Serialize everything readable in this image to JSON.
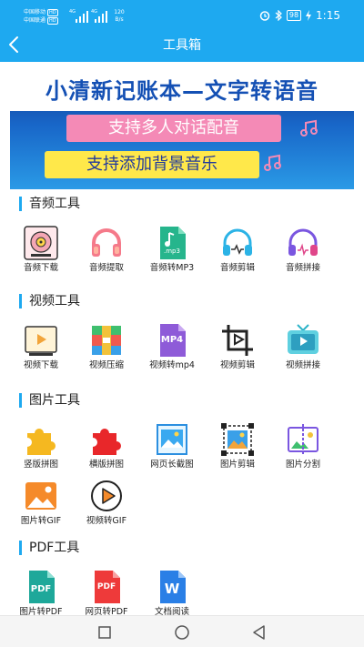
{
  "status_bar": {
    "carrier1": "中国移动",
    "carrier1_tag": "HD",
    "carrier2": "中国联通",
    "carrier2_tag": "HD",
    "network1": "4G",
    "network2": "4G",
    "speed_value": "120",
    "speed_unit": "B/s",
    "battery": "98",
    "time": "1:15"
  },
  "header": {
    "title": "工具箱"
  },
  "banner": {
    "title": "小清新记账本—文字转语音",
    "line1": "支持多人对话配音",
    "line2": "支持添加背景音乐"
  },
  "sections": {
    "audio": {
      "title": "音频工具",
      "items": [
        "音频下载",
        "音频提取",
        "音频转MP3",
        "音频剪辑",
        "音频拼接"
      ]
    },
    "video": {
      "title": "视频工具",
      "items": [
        "视频下载",
        "视频压缩",
        "视频转mp4",
        "视频剪辑",
        "视频拼接"
      ]
    },
    "image": {
      "title": "图片工具",
      "items": [
        "竖版拼图",
        "横版拼图",
        "网页长截图",
        "图片剪辑",
        "图片分割",
        "图片转GIF",
        "视频转GIF"
      ]
    },
    "pdf": {
      "title": "PDF工具",
      "items": [
        "图片转PDF",
        "网页转PDF",
        "文档阅读"
      ]
    }
  },
  "icon_labels": {
    "mp3": ".mp3",
    "mp4": "MP4",
    "pdf": "PDF",
    "word": "W"
  },
  "colors": {
    "accent": "#1ea9f0",
    "banner_pink": "#f48ab6",
    "banner_yellow": "#ffe84a"
  }
}
